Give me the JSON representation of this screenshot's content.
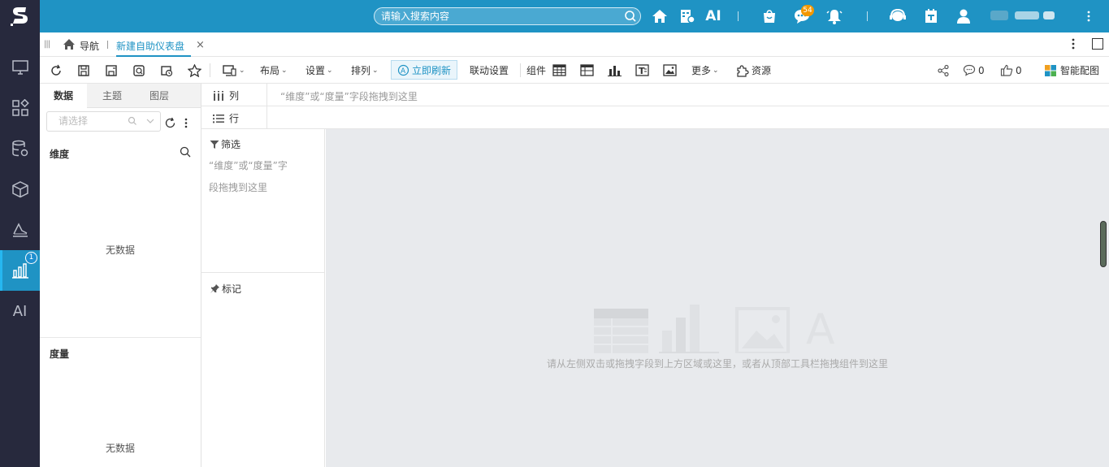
{
  "header": {
    "search_placeholder": "请输入搜索内容",
    "ai_label": "AI",
    "messages_badge": "54"
  },
  "sidebar": {
    "items": [
      {
        "icon": "monitor-icon"
      },
      {
        "icon": "apps-icon"
      },
      {
        "icon": "database-gear-icon"
      },
      {
        "icon": "cube-icon"
      },
      {
        "icon": "chart-area-icon"
      },
      {
        "icon": "bar-chart-icon",
        "badge": "1"
      },
      {
        "label": "AI"
      }
    ]
  },
  "tabbar": {
    "nav_label": "导航",
    "active_tab": "新建自助仪表盘",
    "close": "×"
  },
  "toolbar": {
    "layout_label": "布局",
    "settings_label": "设置",
    "arrange_label": "排列",
    "refresh_label": "立即刷新",
    "linkage_label": "联动设置",
    "components_label": "组件",
    "more_label": "更多",
    "resources_label": "资源",
    "comments_count": "0",
    "likes_count": "0",
    "smart_chart_label": "智能配图"
  },
  "left_panel": {
    "tabs": [
      "数据",
      "主题",
      "图层"
    ],
    "select_placeholder": "请选择",
    "dimensions_title": "维度",
    "measures_title": "度量",
    "no_data": "无数据"
  },
  "shelves": {
    "columns_label": "列",
    "rows_label": "行",
    "columns_hint": "“维度”或“度量”字段拖拽到这里"
  },
  "filter_pane": {
    "filter_label": "筛选",
    "filter_hint_line1": "“维度”或“度量”字",
    "filter_hint_line2": "段拖拽到这里",
    "marks_label": "标记"
  },
  "canvas": {
    "empty_message": "请从左侧双击或拖拽字段到上方区域或这里，或者从顶部工具栏拖拽组件到这里",
    "placeholder_letter": "A"
  },
  "colors": {
    "brand": "#1f93c4",
    "sidebar": "#27293d",
    "canvas": "#e8eaed",
    "badge": "#f39800"
  }
}
